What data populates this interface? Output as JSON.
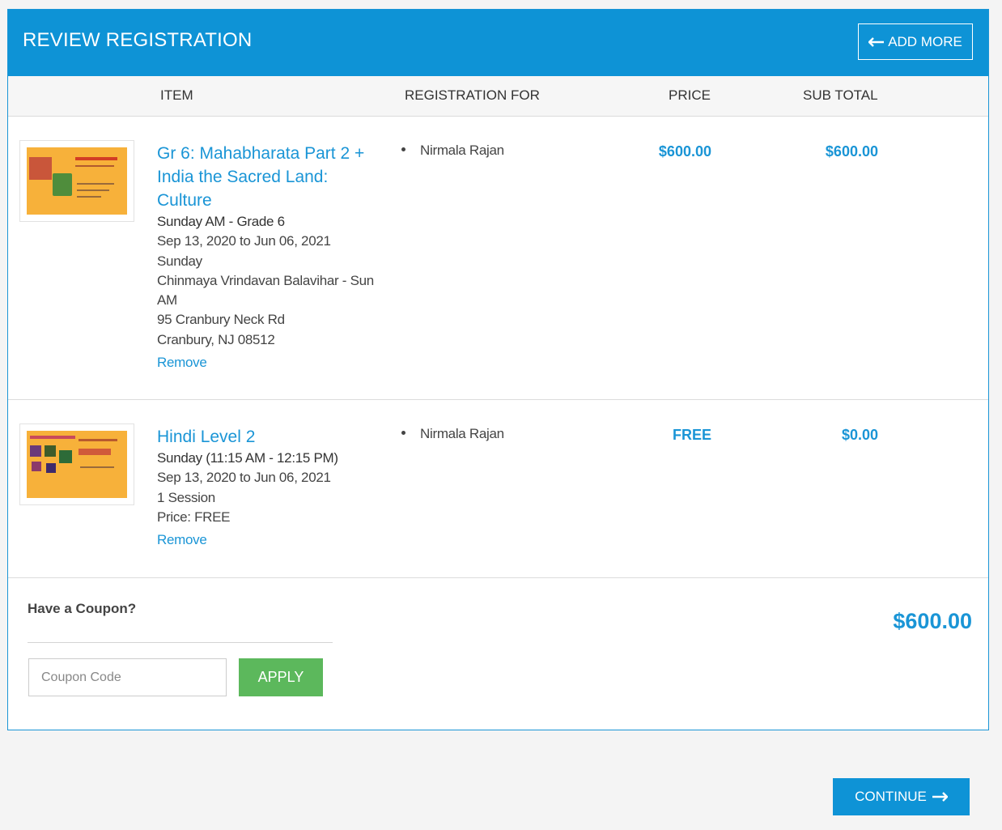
{
  "header": {
    "title": "REVIEW REGISTRATION",
    "add_more_label": "ADD MORE"
  },
  "columns": {
    "item": "ITEM",
    "registration_for": "REGISTRATION FOR",
    "price": "PRICE",
    "sub_total": "SUB TOTAL"
  },
  "items": [
    {
      "title_lines": [
        "Gr 6: Mahabharata Part 2 +",
        "India the Sacred Land:",
        "Culture"
      ],
      "details": [
        "Sunday AM - Grade 6",
        "Sep 13, 2020 to Jun 06, 2021",
        "Sunday",
        "Chinmaya Vrindavan Balavihar - Sun",
        "AM",
        "95 Cranbury Neck Rd",
        "Cranbury, NJ 08512"
      ],
      "remove_label": "Remove",
      "registrant": "Nirmala Rajan",
      "price": "$600.00",
      "subtotal": "$600.00"
    },
    {
      "title_lines": [
        "Hindi Level 2"
      ],
      "details": [
        "Sunday (11:15 AM - 12:15 PM)",
        "Sep 13, 2020 to Jun 06, 2021",
        "1 Session",
        "Price: FREE"
      ],
      "remove_label": "Remove",
      "registrant": "Nirmala Rajan",
      "price": "FREE",
      "subtotal": "$0.00"
    }
  ],
  "coupon": {
    "label": "Have a Coupon?",
    "placeholder": "Coupon Code",
    "apply_label": "APPLY"
  },
  "total": "$600.00",
  "continue_label": "CONTINUE",
  "icons": {
    "add_more": "arrow-left-icon",
    "continue": "arrow-right-icon"
  },
  "colors": {
    "primary": "#0e93d6",
    "link": "#1a95d6",
    "apply": "#5cb85c"
  }
}
